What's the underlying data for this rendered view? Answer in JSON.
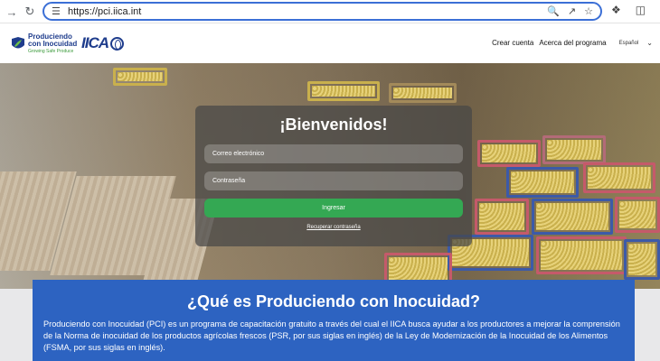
{
  "browser": {
    "url": "https://pci.iica.int"
  },
  "header": {
    "logo_line1": "Produciendo",
    "logo_line2": "con Inocuidad",
    "logo_tagline": "Growing Safe Produce",
    "partner_logo": "IICA",
    "nav": {
      "create_account": "Crear cuenta",
      "about": "Acerca del programa",
      "language": "Español"
    }
  },
  "login": {
    "title": "¡Bienvenidos!",
    "email_placeholder": "Correo electrónico",
    "password_placeholder": "Contraseña",
    "submit_label": "Ingresar",
    "recover_link": "Recuperar contraseña"
  },
  "info": {
    "title": "¿Qué es Produciendo con Inocuidad?",
    "body": "Produciendo con Inocuidad (PCI) es un programa de capacitación gratuito a través del cual el IICA busca ayudar a los productores a mejorar la comprensión de la Norma de inocuidad de los productos agrícolas frescos (PSR, por sus siglas en inglés) de la Ley de Modernización de la Inocuidad de los Alimentos (FSMA, por sus siglas en inglés)."
  },
  "colors": {
    "accent_blue": "#2d63c1",
    "login_green": "#34a853",
    "brand_navy": "#1e3c8c"
  }
}
